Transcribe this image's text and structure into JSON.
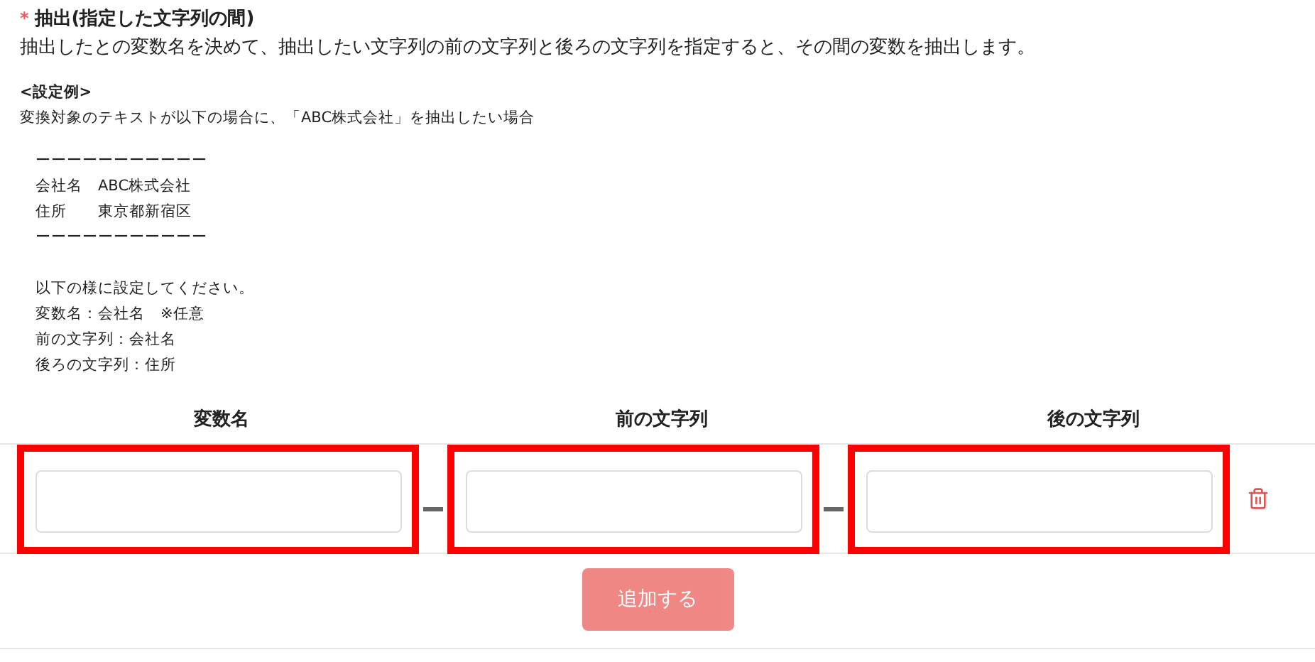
{
  "field": {
    "required_mark": "*",
    "label": "抽出(指定した文字列の間)",
    "description": "抽出したとの変数名を決めて、抽出したい文字列の前の文字列と後ろの文字列を指定すると、その間の変数を抽出します。"
  },
  "example": {
    "heading": "<設定例>",
    "intro": "変換対象のテキストが以下の場合に、「ABC株式会社」を抽出したい場合",
    "sample_lines": [
      {
        "text": "ーーーーーーーーーーー"
      },
      {
        "text": "会社名　ABC株式会社"
      },
      {
        "text": "住所　　東京都新宿区"
      },
      {
        "text": "ーーーーーーーーーーー"
      }
    ],
    "instruction_lines": [
      {
        "text": "以下の様に設定してください。"
      },
      {
        "text": "変数名：会社名　※任意"
      },
      {
        "text": "前の文字列：会社名"
      },
      {
        "text": "後ろの文字列：住所"
      }
    ]
  },
  "columns": [
    "変数名",
    "前の文字列",
    "後の文字列"
  ],
  "row": {
    "fields": [
      {
        "highlighted": true
      },
      {
        "highlighted": true
      },
      {
        "highlighted": true
      }
    ]
  },
  "add_button": {
    "label": "追加する",
    "disabled": true
  }
}
